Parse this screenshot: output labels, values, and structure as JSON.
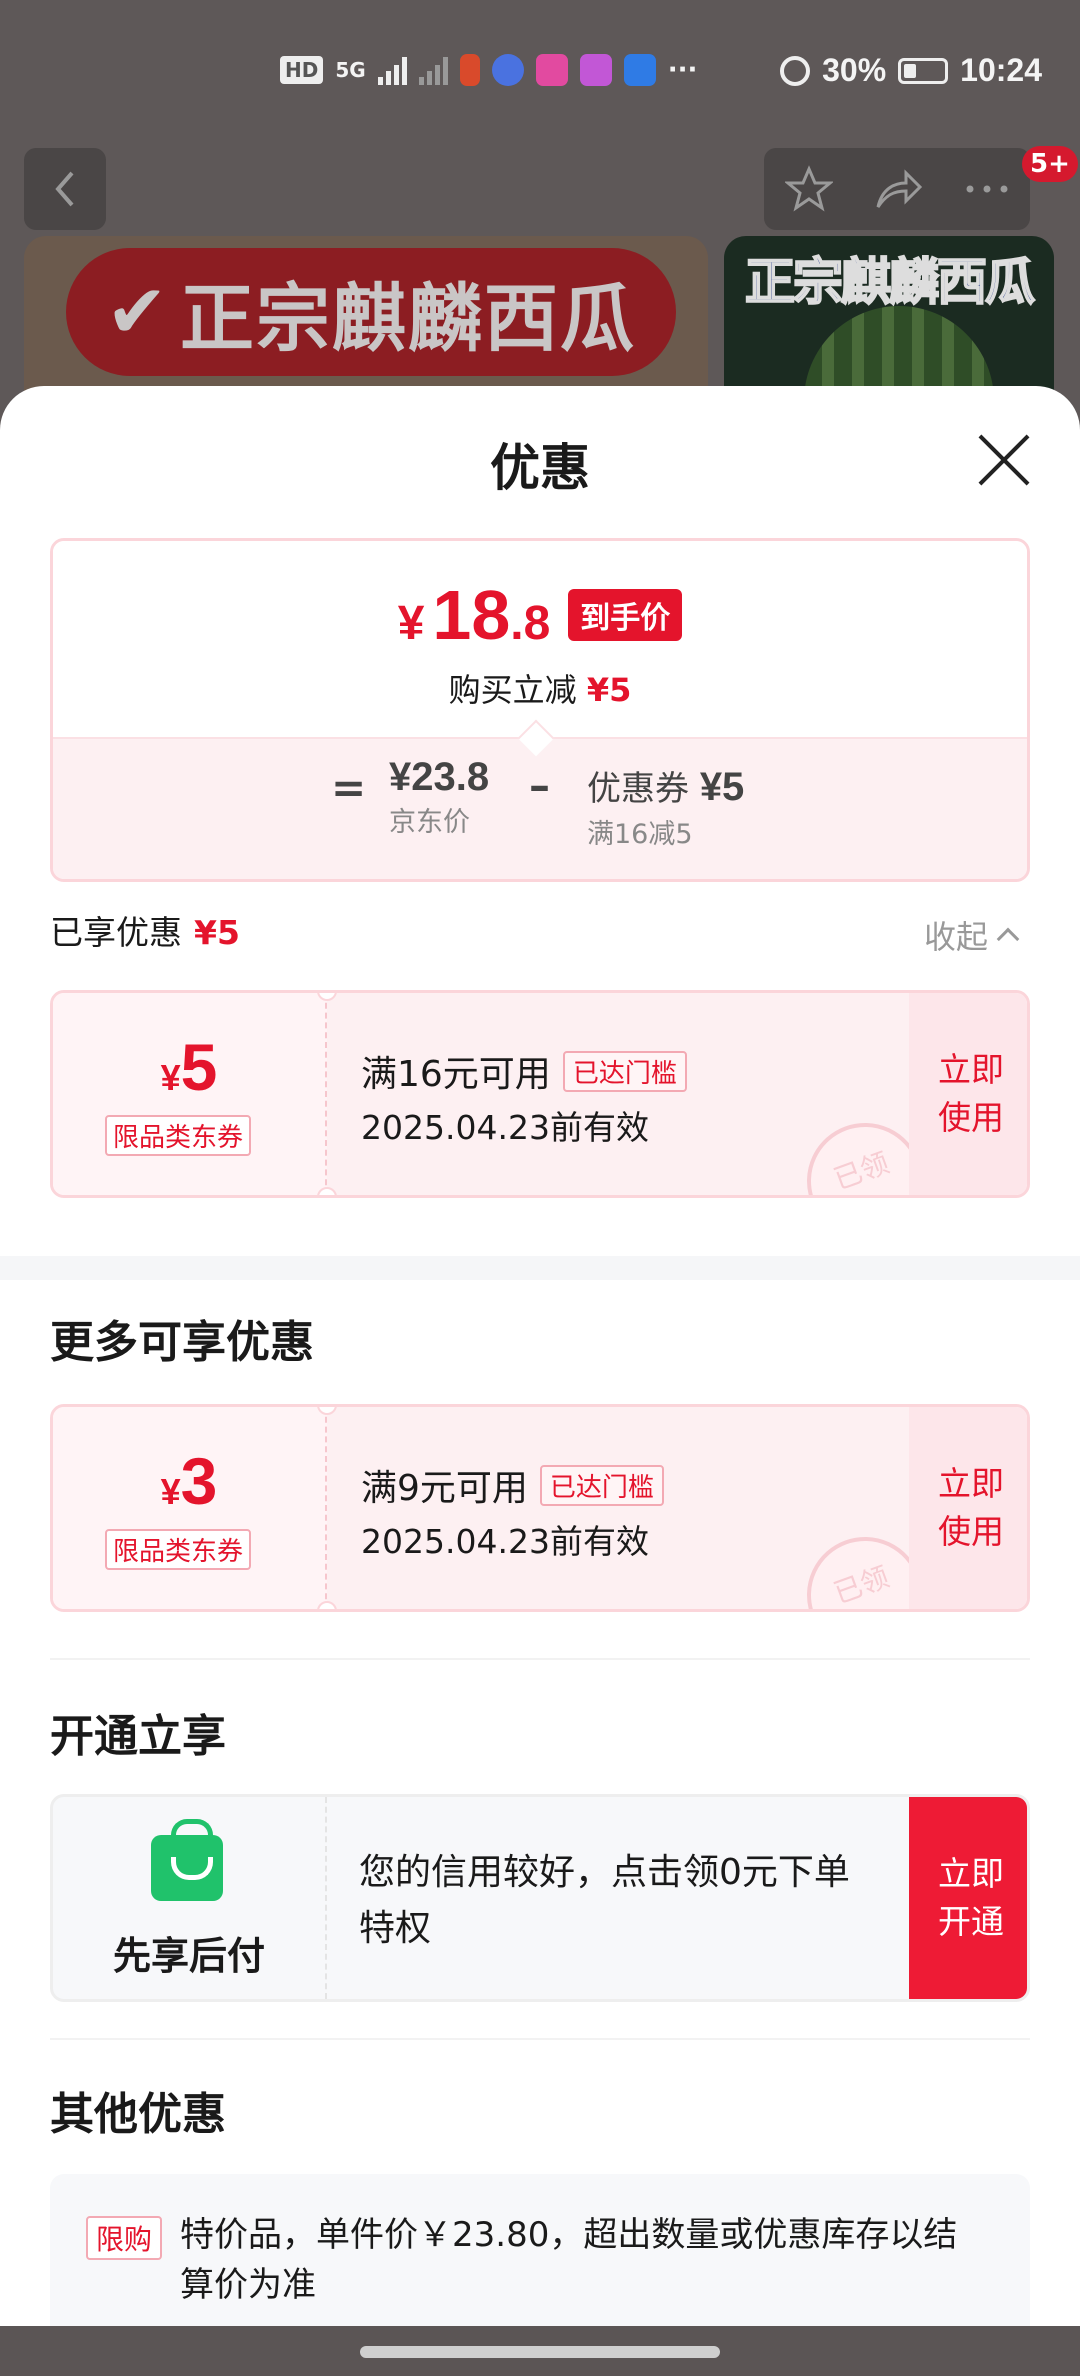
{
  "status_bar": {
    "hd": "HD",
    "net": "5G",
    "battery": "30%",
    "time": "10:24",
    "more": "···"
  },
  "top_nav": {
    "badge": "5+"
  },
  "banners": {
    "left_text": "正宗麒麟西瓜",
    "right_text": "正宗麒麟西瓜"
  },
  "sheet": {
    "title": "优惠"
  },
  "price_summary": {
    "currency": "¥",
    "final_int": "18",
    "final_dec": ".8",
    "final_tag": "到手价",
    "reduce_label": "购买立减",
    "reduce_amount": "¥5",
    "equals": "=",
    "jd_price": "¥23.8",
    "jd_price_label": "京东价",
    "minus": "–",
    "coupon_label": "优惠券",
    "coupon_amount": "¥5",
    "coupon_rule": "满16减5"
  },
  "enjoyed": {
    "label": "已享优惠",
    "amount": "¥5",
    "collapse": "收起"
  },
  "coupons_used": [
    {
      "currency": "¥",
      "amount": "5",
      "kind": "限品类东券",
      "condition": "满16元可用",
      "status": "已达门槛",
      "validity": "2025.04.23前有效",
      "stamp": "已领",
      "action": "立即使用"
    }
  ],
  "more_section": {
    "title": "更多可享优惠",
    "coupons": [
      {
        "currency": "¥",
        "amount": "3",
        "kind": "限品类东券",
        "condition": "满9元可用",
        "status": "已达门槛",
        "validity": "2025.04.23前有效",
        "stamp": "已领",
        "action": "立即使用"
      }
    ]
  },
  "open_section": {
    "title": "开通立享",
    "name": "先享后付",
    "desc": "您的信用较好，点击领0元下单特权",
    "action": "立即开通"
  },
  "other_section": {
    "title": "其他优惠",
    "tag": "限购",
    "text": "特价品，单件价￥23.80，超出数量或优惠库存以结算价为准"
  },
  "colors": {
    "accent": "#e4142c",
    "pay_green": "#20c26b",
    "open_btn": "#ee1b35"
  }
}
